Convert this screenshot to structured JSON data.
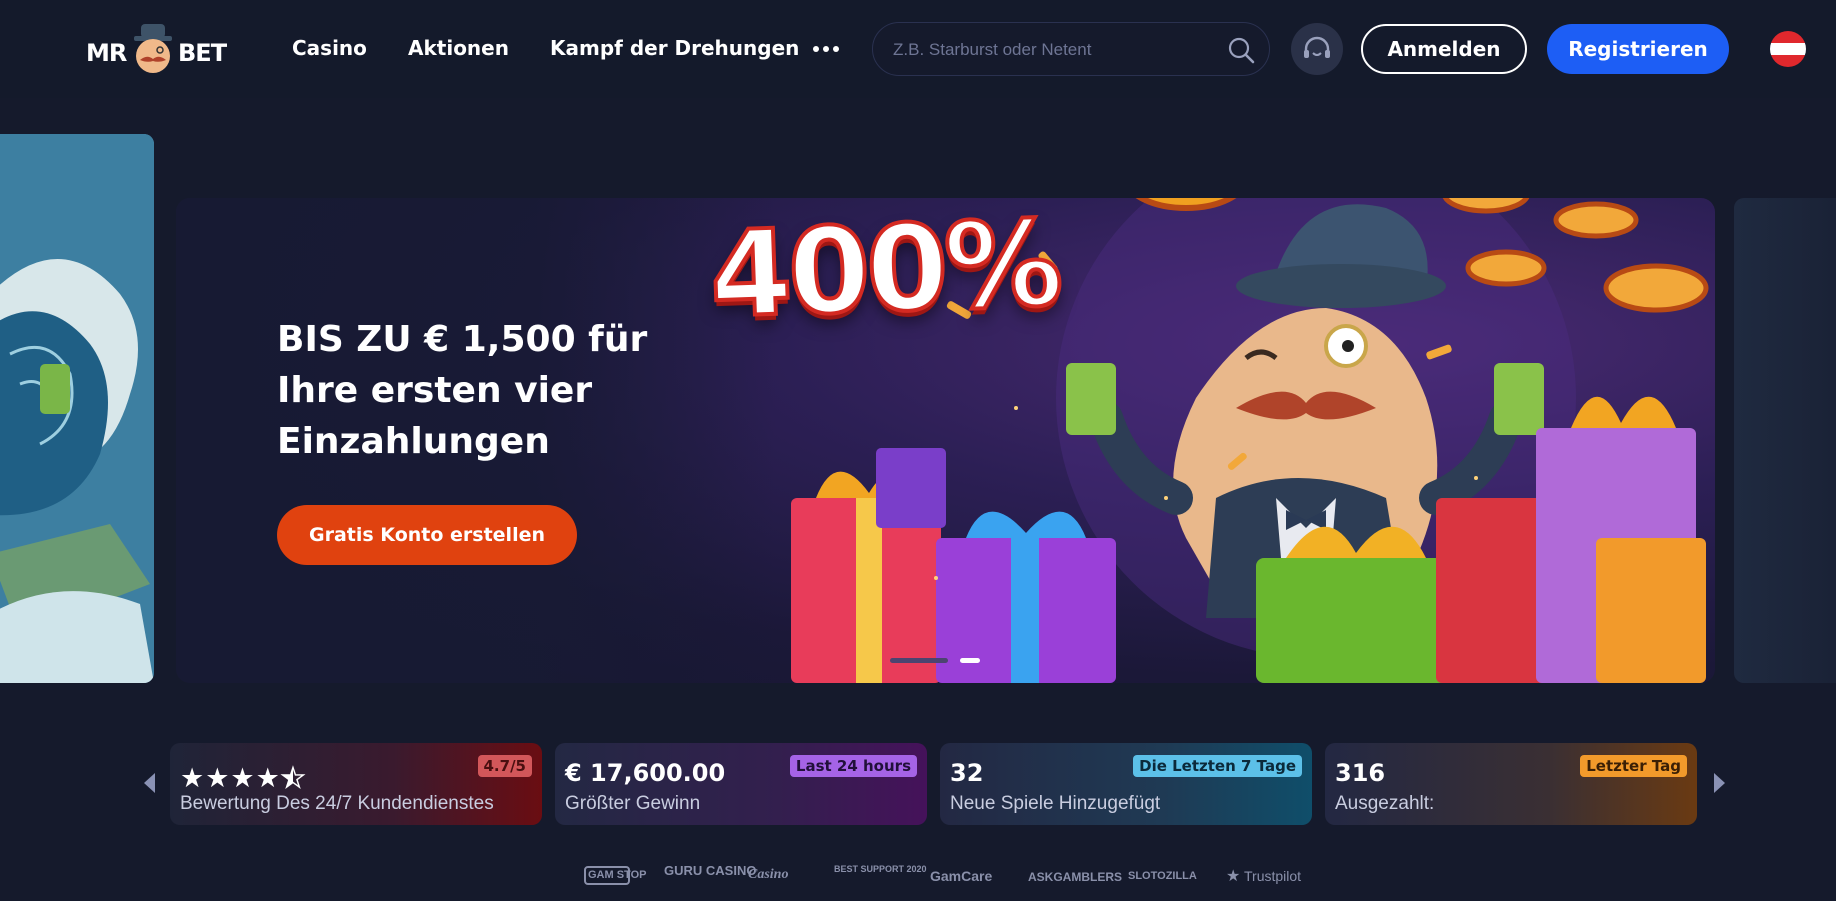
{
  "header": {
    "logo": {
      "left": "MR",
      "right": "BET"
    },
    "nav": [
      {
        "label": "Casino"
      },
      {
        "label": "Aktionen"
      },
      {
        "label": "Kampf der Drehungen"
      }
    ],
    "search": {
      "placeholder": "Z.B. Starburst oder Netent"
    },
    "login_label": "Anmelden",
    "register_label": "Registrieren",
    "colors": {
      "register": "#1d5ef5",
      "cta": "#e0420f",
      "background": "#151a2c"
    }
  },
  "hero": {
    "percent": "400%",
    "title": "BIS ZU € 1,500 für Ihre ersten vier Einzahlungen",
    "cta_label": "Gratis Konto erstellen",
    "slides": {
      "count": 2,
      "active": 2
    }
  },
  "stats": {
    "cards": [
      {
        "rating_stars": 4.5,
        "badge": "4.7/5",
        "label": "Bewertung Des 24/7 Kundendienstes",
        "badge_color": "#d2575a"
      },
      {
        "value": "€ 17,600.00",
        "badge": "Last 24 hours",
        "label": "Größter Gewinn",
        "badge_color": "#a563e6"
      },
      {
        "value": "32",
        "badge": "Die Letzten 7 Tage",
        "label": "Neue Spiele Hinzugefügt",
        "badge_color": "#5cc0e8"
      },
      {
        "value": "316",
        "badge": "Letzter Tag",
        "label": "Ausgezahlt:",
        "badge_color": "#f29a2b"
      }
    ]
  },
  "partners": [
    {
      "label": "GAM STOP"
    },
    {
      "label": "GURU CASINO"
    },
    {
      "label": "Casino"
    },
    {
      "label": "BEST SUPPORT 2020"
    },
    {
      "label": "GamCare"
    },
    {
      "label": "ASKGAMBLERS"
    },
    {
      "label": "SLOTOZILLA"
    },
    {
      "label": "Trustpilot"
    }
  ]
}
